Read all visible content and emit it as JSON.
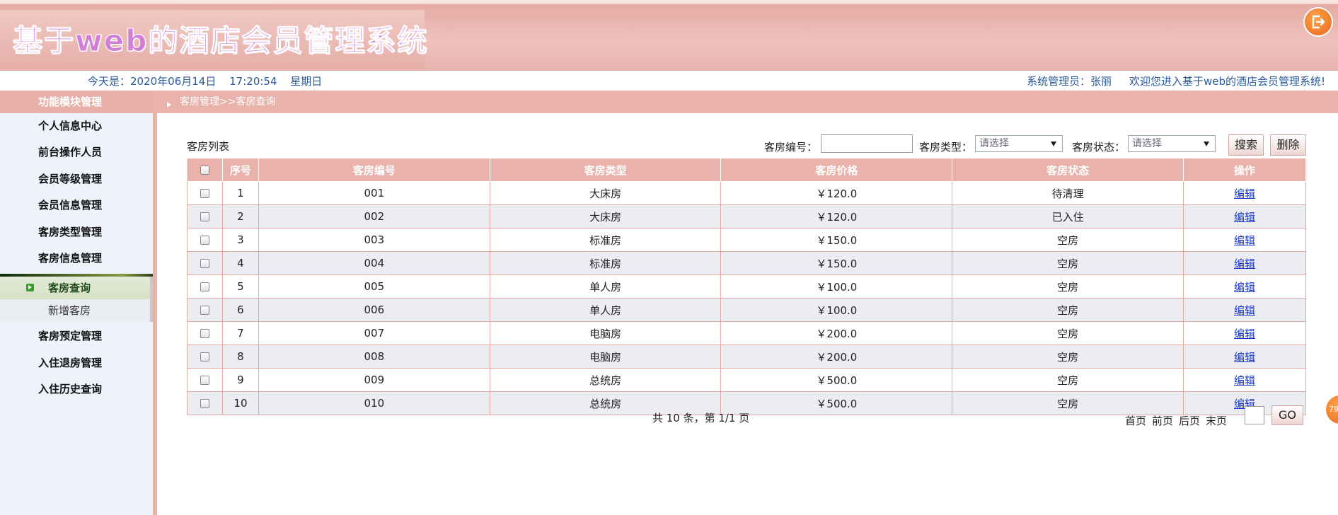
{
  "header": {
    "title": "基于web的酒店会员管理系统"
  },
  "info_bar": {
    "date_label": "今天是：2020年06月14日",
    "time": "17:20:54",
    "weekday": "星期日",
    "admin": "系统管理员：张丽",
    "welcome": "欢迎您进入基于web的酒店会员管理系统!"
  },
  "sidebar": {
    "title": "功能模块管理",
    "items": [
      {
        "label": "个人信息中心"
      },
      {
        "label": "前台操作人员"
      },
      {
        "label": "会员等级管理"
      },
      {
        "label": "会员信息管理"
      },
      {
        "label": "客房类型管理"
      },
      {
        "label": "客房信息管理"
      },
      {
        "label": "客房预定管理"
      },
      {
        "label": "入住退房管理"
      },
      {
        "label": "入住历史查询"
      }
    ],
    "submenu": {
      "active": "客房查询",
      "item": "新增客房"
    }
  },
  "breadcrumb": "客房管理>>客房查询",
  "list_title": "客房列表",
  "search": {
    "room_no_label": "客房编号：",
    "room_no_value": "",
    "type_label": "客房类型：",
    "type_value": "请选择",
    "status_label": "客房状态：",
    "status_value": "请选择",
    "search_button": "搜索",
    "delete_button": "删除"
  },
  "table": {
    "columns": [
      "序号",
      "客房编号",
      "客房类型",
      "客房价格",
      "客房状态",
      "操作"
    ],
    "edit_label": "编辑",
    "rows": [
      {
        "seq": "1",
        "no": "001",
        "type": "大床房",
        "price": "￥120.0",
        "status": "待清理"
      },
      {
        "seq": "2",
        "no": "002",
        "type": "大床房",
        "price": "￥120.0",
        "status": "已入住"
      },
      {
        "seq": "3",
        "no": "003",
        "type": "标准房",
        "price": "￥150.0",
        "status": "空房"
      },
      {
        "seq": "4",
        "no": "004",
        "type": "标准房",
        "price": "￥150.0",
        "status": "空房"
      },
      {
        "seq": "5",
        "no": "005",
        "type": "单人房",
        "price": "￥100.0",
        "status": "空房"
      },
      {
        "seq": "6",
        "no": "006",
        "type": "单人房",
        "price": "￥100.0",
        "status": "空房"
      },
      {
        "seq": "7",
        "no": "007",
        "type": "电脑房",
        "price": "￥200.0",
        "status": "空房"
      },
      {
        "seq": "8",
        "no": "008",
        "type": "电脑房",
        "price": "￥200.0",
        "status": "空房"
      },
      {
        "seq": "9",
        "no": "009",
        "type": "总统房",
        "price": "￥500.0",
        "status": "空房"
      },
      {
        "seq": "10",
        "no": "010",
        "type": "总统房",
        "price": "￥500.0",
        "status": "空房"
      }
    ]
  },
  "pager": {
    "summary": "共 10 条，第 1/1 页",
    "first": "首页",
    "prev": "前页",
    "next": "后页",
    "last": "末页",
    "page_input": "",
    "go_label": "GO"
  },
  "float_widget": "79"
}
